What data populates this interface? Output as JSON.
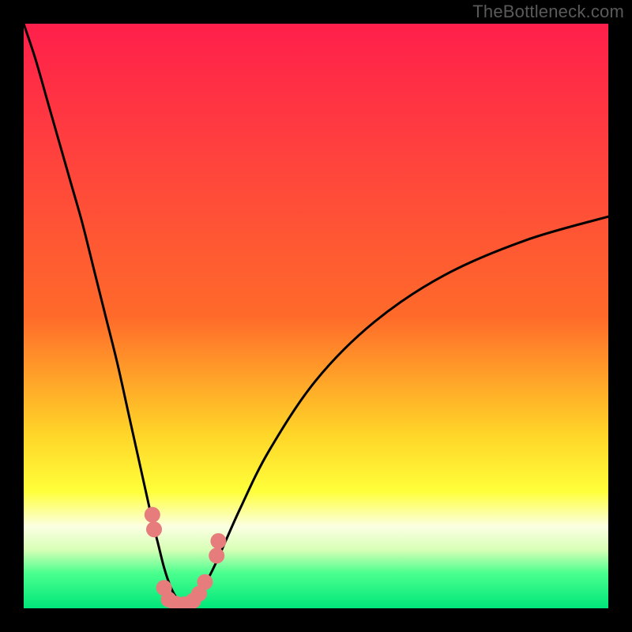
{
  "watermark": "TheBottleneck.com",
  "colors": {
    "frame": "#000000",
    "gradient_top": "#ff1f4b",
    "gradient_mid1": "#ff6a2a",
    "gradient_mid2": "#ffd428",
    "gradient_mid3": "#ffff3a",
    "gradient_pale": "#fbffe2",
    "green_light": "#d7ffb6",
    "green_mid": "#4aff8e",
    "green_sat": "#00e67a",
    "curve_stroke": "#000000",
    "marker_fill": "#e77c7c",
    "marker_stroke": "#d26666"
  },
  "chart_data": {
    "type": "line",
    "title": "",
    "xlabel": "",
    "ylabel": "",
    "xlim": [
      0,
      100
    ],
    "ylim": [
      0,
      100
    ],
    "series": [
      {
        "name": "bottleneck-curve",
        "x": [
          0,
          2,
          4,
          6,
          8,
          10,
          12,
          14,
          16,
          18,
          20,
          22,
          23,
          24,
          25,
          26,
          27,
          28,
          29,
          30,
          31,
          33,
          37,
          42,
          50,
          60,
          72,
          86,
          100
        ],
        "y": [
          100,
          94,
          87,
          80,
          73,
          66,
          58,
          50,
          42,
          33,
          24,
          15,
          11,
          7,
          4,
          2,
          1,
          0.7,
          1,
          2,
          4,
          8,
          17,
          27,
          39,
          49,
          57,
          63,
          67
        ]
      }
    ],
    "markers": [
      {
        "x": 22.0,
        "y": 16.0
      },
      {
        "x": 22.3,
        "y": 13.5
      },
      {
        "x": 24.0,
        "y": 3.5
      },
      {
        "x": 24.8,
        "y": 1.5
      },
      {
        "x": 26.0,
        "y": 0.8
      },
      {
        "x": 27.5,
        "y": 0.7
      },
      {
        "x": 29.0,
        "y": 1.3
      },
      {
        "x": 30.0,
        "y": 2.5
      },
      {
        "x": 31.0,
        "y": 4.5
      },
      {
        "x": 33.0,
        "y": 9.0
      },
      {
        "x": 33.3,
        "y": 11.5
      }
    ]
  }
}
